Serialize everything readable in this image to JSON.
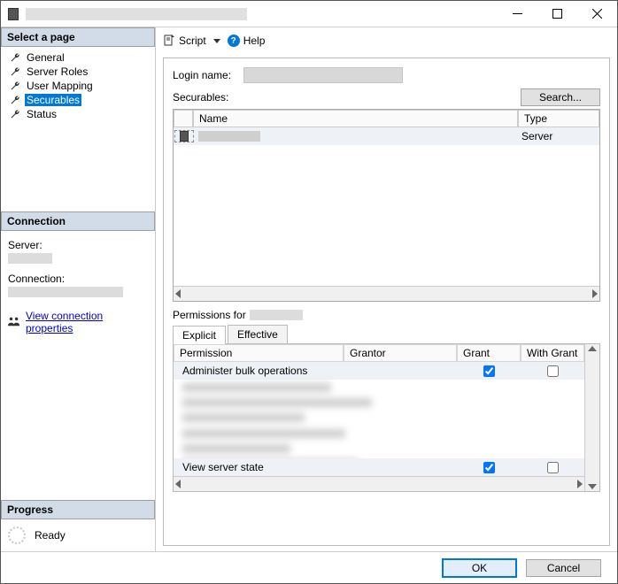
{
  "titlebar": {
    "title": ""
  },
  "left": {
    "select_page": "Select a page",
    "items": [
      {
        "label": "General"
      },
      {
        "label": "Server Roles"
      },
      {
        "label": "User Mapping"
      },
      {
        "label": "Securables",
        "selected": true
      },
      {
        "label": "Status"
      }
    ],
    "connection_header": "Connection",
    "server_label": "Server:",
    "connection_label": "Connection:",
    "view_conn_link": "View connection properties",
    "progress_header": "Progress",
    "progress_status": "Ready"
  },
  "toolbar": {
    "script": "Script",
    "help": "Help"
  },
  "form": {
    "login_name_label": "Login name:",
    "securables_label": "Securables:",
    "search_btn": "Search..."
  },
  "sec_grid": {
    "col_name": "Name",
    "col_type": "Type",
    "rows": [
      {
        "name": "",
        "type": "Server"
      }
    ]
  },
  "perm": {
    "label_prefix": "Permissions for",
    "tabs": {
      "explicit": "Explicit",
      "effective": "Effective"
    },
    "cols": {
      "permission": "Permission",
      "grantor": "Grantor",
      "grant": "Grant",
      "with_grant": "With Grant"
    },
    "rows": [
      {
        "permission": "Administer bulk operations",
        "grant": true,
        "with_grant": false
      },
      {
        "permission": "View server state",
        "grant": true,
        "with_grant": false
      }
    ]
  },
  "footer": {
    "ok": "OK",
    "cancel": "Cancel"
  }
}
